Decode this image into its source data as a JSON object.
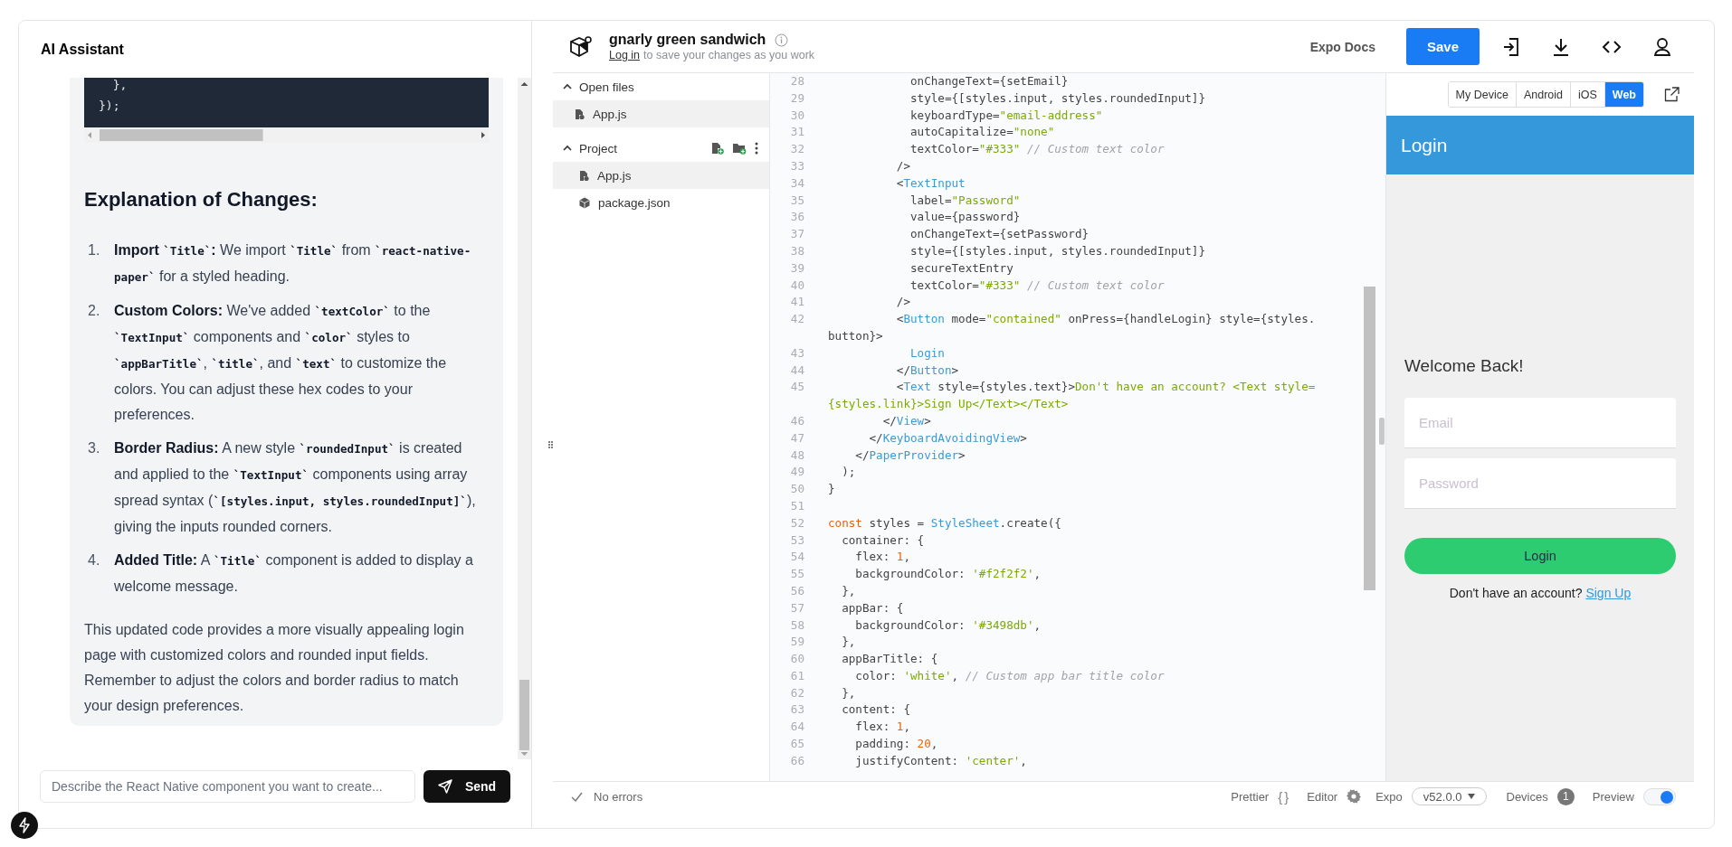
{
  "assistant": {
    "title": "AI Assistant",
    "code_block": {
      "lines": [
        "  },",
        "});"
      ]
    },
    "heading": "Explanation of Changes:",
    "items": [
      {
        "number": "1.",
        "parts": [
          {
            "kind": "bold",
            "text": "Import "
          },
          {
            "kind": "code",
            "text": "`Title`"
          },
          {
            "kind": "bold",
            "text": ":"
          },
          {
            "kind": "text",
            "text": " We import "
          },
          {
            "kind": "code",
            "text": "`Title`"
          },
          {
            "kind": "text",
            "text": " from "
          },
          {
            "kind": "code",
            "text": "`react-native-paper`"
          },
          {
            "kind": "text",
            "text": " for a styled heading."
          }
        ]
      },
      {
        "number": "2.",
        "parts": [
          {
            "kind": "bold",
            "text": "Custom Colors:"
          },
          {
            "kind": "text",
            "text": " We've added "
          },
          {
            "kind": "code",
            "text": "`textColor`"
          },
          {
            "kind": "text",
            "text": " to the "
          },
          {
            "kind": "code",
            "text": "`TextInput`"
          },
          {
            "kind": "text",
            "text": " components and "
          },
          {
            "kind": "code",
            "text": "`color`"
          },
          {
            "kind": "text",
            "text": " styles to "
          },
          {
            "kind": "code",
            "text": "`appBarTitle`"
          },
          {
            "kind": "text",
            "text": ", "
          },
          {
            "kind": "code",
            "text": "`title`"
          },
          {
            "kind": "text",
            "text": ", and "
          },
          {
            "kind": "code",
            "text": "`text`"
          },
          {
            "kind": "text",
            "text": " to customize the colors. You can adjust these hex codes to your preferences."
          }
        ]
      },
      {
        "number": "3.",
        "parts": [
          {
            "kind": "bold",
            "text": "Border Radius:"
          },
          {
            "kind": "text",
            "text": " A new style "
          },
          {
            "kind": "code",
            "text": "`roundedInput`"
          },
          {
            "kind": "text",
            "text": " is created and applied to the "
          },
          {
            "kind": "code",
            "text": "`TextInput`"
          },
          {
            "kind": "text",
            "text": " components using array spread syntax ("
          },
          {
            "kind": "code",
            "text": "`[styles.input, styles.roundedInput]`"
          },
          {
            "kind": "text",
            "text": "), giving the inputs rounded corners."
          }
        ]
      },
      {
        "number": "4.",
        "parts": [
          {
            "kind": "bold",
            "text": "Added Title:"
          },
          {
            "kind": "text",
            "text": " A "
          },
          {
            "kind": "code",
            "text": "`Title`"
          },
          {
            "kind": "text",
            "text": " component is added to display a welcome message."
          }
        ]
      }
    ],
    "summary": "This updated code provides a more visually appealing login page with customized colors and rounded input fields. Remember to adjust the colors and border radius to match your design preferences.",
    "input": {
      "placeholder": "Describe the React Native component you want to create..."
    },
    "send_button": "Send"
  },
  "project": {
    "title": "gnarly green sandwich",
    "login_link": "Log in",
    "login_note": "to save your changes as you work"
  },
  "toolbar": {
    "docs_link": "Expo Docs",
    "save_button": "Save"
  },
  "files": {
    "sections": [
      {
        "label": "Open files",
        "expanded": true,
        "actions": false,
        "items": [
          {
            "name": "App.js",
            "kind": "js",
            "selected": true
          }
        ]
      },
      {
        "label": "Project",
        "expanded": true,
        "actions": true,
        "items": [
          {
            "name": "App.js",
            "kind": "js",
            "selected": true
          },
          {
            "name": "package.json",
            "kind": "package",
            "selected": false
          }
        ]
      }
    ]
  },
  "editor": {
    "rows": [
      {
        "num": "28",
        "tokens": [
          {
            "kind": "plain",
            "text": "            onChangeText={setEmail}"
          }
        ]
      },
      {
        "num": "29",
        "tokens": [
          {
            "kind": "plain",
            "text": "            style={[styles.input, styles.roundedInput]}"
          }
        ]
      },
      {
        "num": "30",
        "tokens": [
          {
            "kind": "plain",
            "text": "            keyboardType="
          },
          {
            "kind": "string",
            "text": "\"email-address\""
          }
        ]
      },
      {
        "num": "31",
        "tokens": [
          {
            "kind": "plain",
            "text": "            autoCapitalize="
          },
          {
            "kind": "string",
            "text": "\"none\""
          }
        ]
      },
      {
        "num": "32",
        "tokens": [
          {
            "kind": "plain",
            "text": "            textColor="
          },
          {
            "kind": "string",
            "text": "\"#333\""
          },
          {
            "kind": "comment",
            "text": " // Custom text color"
          }
        ]
      },
      {
        "num": "33",
        "tokens": [
          {
            "kind": "plain",
            "text": "          />"
          }
        ]
      },
      {
        "num": "34",
        "tokens": [
          {
            "kind": "plain",
            "text": "          <"
          },
          {
            "kind": "tag",
            "text": "TextInput"
          }
        ]
      },
      {
        "num": "35",
        "tokens": [
          {
            "kind": "plain",
            "text": "            label="
          },
          {
            "kind": "string",
            "text": "\"Password\""
          }
        ]
      },
      {
        "num": "36",
        "tokens": [
          {
            "kind": "plain",
            "text": "            value={password}"
          }
        ]
      },
      {
        "num": "37",
        "tokens": [
          {
            "kind": "plain",
            "text": "            onChangeText={setPassword}"
          }
        ]
      },
      {
        "num": "38",
        "tokens": [
          {
            "kind": "plain",
            "text": "            style={[styles.input, styles.roundedInput]}"
          }
        ]
      },
      {
        "num": "39",
        "tokens": [
          {
            "kind": "plain",
            "text": "            secureTextEntry"
          }
        ]
      },
      {
        "num": "40",
        "tokens": [
          {
            "kind": "plain",
            "text": "            textColor="
          },
          {
            "kind": "string",
            "text": "\"#333\""
          },
          {
            "kind": "comment",
            "text": " // Custom text color"
          }
        ]
      },
      {
        "num": "41",
        "tokens": [
          {
            "kind": "plain",
            "text": "          />"
          }
        ]
      },
      {
        "num": "42",
        "tokens": [
          {
            "kind": "plain",
            "text": "          <"
          },
          {
            "kind": "tag",
            "text": "Button"
          },
          {
            "kind": "plain",
            "text": " mode="
          },
          {
            "kind": "string",
            "text": "\"contained\""
          },
          {
            "kind": "plain",
            "text": " onPress={handleLogin} style={styles."
          }
        ]
      },
      {
        "tokens": [
          {
            "kind": "plain",
            "text": "button}>"
          }
        ]
      },
      {
        "num": "43",
        "tokens": [
          {
            "kind": "tag",
            "text": "            Login"
          }
        ]
      },
      {
        "num": "44",
        "tokens": [
          {
            "kind": "plain",
            "text": "          </"
          },
          {
            "kind": "tag",
            "text": "Button"
          },
          {
            "kind": "plain",
            "text": ">"
          }
        ]
      },
      {
        "num": "45",
        "tokens": [
          {
            "kind": "plain",
            "text": "          <"
          },
          {
            "kind": "tag",
            "text": "Text"
          },
          {
            "kind": "plain",
            "text": " style={styles.text}>"
          },
          {
            "kind": "string",
            "text": "Don't have an account? <Text style="
          }
        ]
      },
      {
        "tokens": [
          {
            "kind": "string",
            "text": "{styles.link}>Sign Up</Text></Text>"
          }
        ]
      },
      {
        "num": "46",
        "tokens": [
          {
            "kind": "plain",
            "text": "        </"
          },
          {
            "kind": "tag",
            "text": "View"
          },
          {
            "kind": "plain",
            "text": ">"
          }
        ]
      },
      {
        "num": "47",
        "tokens": [
          {
            "kind": "plain",
            "text": "      </"
          },
          {
            "kind": "tag",
            "text": "KeyboardAvoidingView"
          },
          {
            "kind": "plain",
            "text": ">"
          }
        ]
      },
      {
        "num": "48",
        "tokens": [
          {
            "kind": "plain",
            "text": "    </"
          },
          {
            "kind": "tag",
            "text": "PaperProvider"
          },
          {
            "kind": "plain",
            "text": ">"
          }
        ]
      },
      {
        "num": "49",
        "tokens": [
          {
            "kind": "plain",
            "text": "  );"
          }
        ]
      },
      {
        "num": "50",
        "tokens": [
          {
            "kind": "plain",
            "text": "}"
          }
        ]
      },
      {
        "num": "51"
      },
      {
        "num": "52",
        "tokens": [
          {
            "kind": "keyword",
            "text": "const"
          },
          {
            "kind": "plain",
            "text": " styles = "
          },
          {
            "kind": "tag",
            "text": "StyleSheet"
          },
          {
            "kind": "plain",
            "text": ".create({"
          }
        ]
      },
      {
        "num": "53",
        "tokens": [
          {
            "kind": "plain",
            "text": "  container: {"
          }
        ]
      },
      {
        "num": "54",
        "tokens": [
          {
            "kind": "plain",
            "text": "    flex: "
          },
          {
            "kind": "number",
            "text": "1"
          },
          {
            "kind": "plain",
            "text": ","
          }
        ]
      },
      {
        "num": "55",
        "tokens": [
          {
            "kind": "plain",
            "text": "    backgroundColor: "
          },
          {
            "kind": "string",
            "text": "'#f2f2f2'"
          },
          {
            "kind": "plain",
            "text": ","
          }
        ]
      },
      {
        "num": "56",
        "tokens": [
          {
            "kind": "plain",
            "text": "  },"
          }
        ]
      },
      {
        "num": "57",
        "tokens": [
          {
            "kind": "plain",
            "text": "  appBar: {"
          }
        ]
      },
      {
        "num": "58",
        "tokens": [
          {
            "kind": "plain",
            "text": "    backgroundColor: "
          },
          {
            "kind": "string",
            "text": "'#3498db'"
          },
          {
            "kind": "plain",
            "text": ","
          }
        ]
      },
      {
        "num": "59",
        "tokens": [
          {
            "kind": "plain",
            "text": "  },"
          }
        ]
      },
      {
        "num": "60",
        "tokens": [
          {
            "kind": "plain",
            "text": "  appBarTitle: {"
          }
        ]
      },
      {
        "num": "61",
        "tokens": [
          {
            "kind": "plain",
            "text": "    color: "
          },
          {
            "kind": "string",
            "text": "'white'"
          },
          {
            "kind": "plain",
            "text": ", "
          },
          {
            "kind": "comment",
            "text": "// Custom app bar title color"
          }
        ]
      },
      {
        "num": "62",
        "tokens": [
          {
            "kind": "plain",
            "text": "  },"
          }
        ]
      },
      {
        "num": "63",
        "tokens": [
          {
            "kind": "plain",
            "text": "  content: {"
          }
        ]
      },
      {
        "num": "64",
        "tokens": [
          {
            "kind": "plain",
            "text": "    flex: "
          },
          {
            "kind": "number",
            "text": "1"
          },
          {
            "kind": "plain",
            "text": ","
          }
        ]
      },
      {
        "num": "65",
        "tokens": [
          {
            "kind": "plain",
            "text": "    padding: "
          },
          {
            "kind": "number",
            "text": "20"
          },
          {
            "kind": "plain",
            "text": ","
          }
        ]
      },
      {
        "num": "66",
        "tokens": [
          {
            "kind": "plain",
            "text": "    justifyContent: "
          },
          {
            "kind": "string",
            "text": "'center'"
          },
          {
            "kind": "plain",
            "text": ","
          }
        ]
      }
    ]
  },
  "preview": {
    "tabs": [
      {
        "label": "My Device",
        "selected": false
      },
      {
        "label": "Android",
        "selected": false
      },
      {
        "label": "iOS",
        "selected": false
      },
      {
        "label": "Web",
        "selected": true
      }
    ],
    "app_bar_title": "Login",
    "heading": "Welcome Back!",
    "fields": [
      {
        "placeholder": "Email"
      },
      {
        "placeholder": "Password"
      }
    ],
    "button": "Login",
    "prompt": "Don't have an account?",
    "link": "Sign Up"
  },
  "status_bar": {
    "status": "No errors",
    "prettier": "Prettier",
    "prettier_icon": "{}",
    "editor": "Editor",
    "expo_label": "Expo",
    "expo_version": "v52.0.0",
    "devices": "Devices",
    "device_count": "1",
    "preview": "Preview",
    "preview_on": true
  }
}
